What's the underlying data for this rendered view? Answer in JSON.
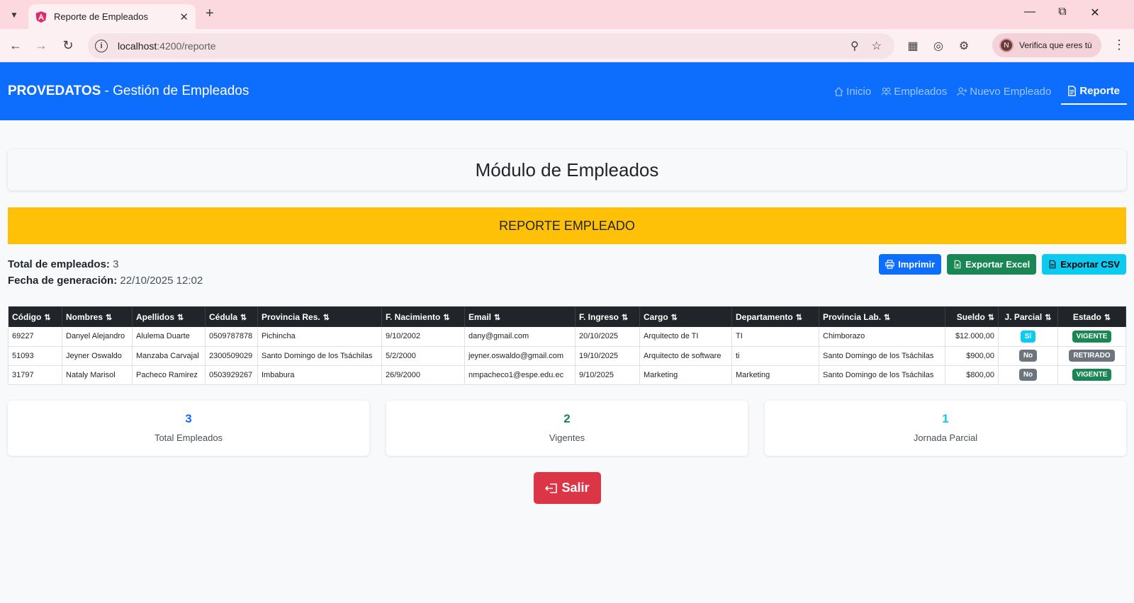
{
  "browser": {
    "tab_title": "Reporte de Empleados",
    "url_host": "localhost",
    "url_rest": ":4200/reporte",
    "profile_label": "Verifica que eres tú",
    "profile_initial": "N"
  },
  "navbar": {
    "brand_bold": "PROVEDATOS",
    "brand_rest": " - Gestión de Empleados",
    "links": [
      {
        "label": "Inicio",
        "icon": "house-icon"
      },
      {
        "label": "Empleados",
        "icon": "people-icon"
      },
      {
        "label": "Nuevo Empleado",
        "icon": "person-add-icon"
      },
      {
        "label": "Reporte",
        "icon": "file-text-icon",
        "active": true
      }
    ]
  },
  "page": {
    "title": "Módulo de Empleados",
    "banner": "REPORTE EMPLEADO",
    "total_label": "Total de empleados:",
    "total_value": "3",
    "fecha_label": "Fecha de generación:",
    "fecha_value": "22/10/2025 12:02"
  },
  "actions": {
    "print": "Imprimir",
    "excel": "Exportar Excel",
    "csv": "Exportar CSV"
  },
  "table": {
    "columns": [
      "Código",
      "Nombres",
      "Apellidos",
      "Cédula",
      "Provincia Res.",
      "F. Nacimiento",
      "Email",
      "F. Ingreso",
      "Cargo",
      "Departamento",
      "Provincia Lab.",
      "Sueldo",
      "J. Parcial",
      "Estado"
    ],
    "rows": [
      {
        "codigo": "69227",
        "nombres": "Danyel Alejandro",
        "apellidos": "Alulema Duarte",
        "cedula": "0509787878",
        "provincia_res": "Pichincha",
        "f_nacimiento": "9/10/2002",
        "email": "dany@gmail.com",
        "f_ingreso": "20/10/2025",
        "cargo": "Arquitecto de TI",
        "departamento": "TI",
        "provincia_lab": "Chimborazo",
        "sueldo": "$12.000,00",
        "j_parcial": "Sí",
        "estado": "VIGENTE"
      },
      {
        "codigo": "51093",
        "nombres": "Jeyner Oswaldo",
        "apellidos": "Manzaba Carvajal",
        "cedula": "2300509029",
        "provincia_res": "Santo Domingo de los Tsáchilas",
        "f_nacimiento": "5/2/2000",
        "email": "jeyner.oswaldo@gmail.com",
        "f_ingreso": "19/10/2025",
        "cargo": "Arquitecto de software",
        "departamento": "ti",
        "provincia_lab": "Santo Domingo de los Tsáchilas",
        "sueldo": "$900,00",
        "j_parcial": "No",
        "estado": "RETIRADO"
      },
      {
        "codigo": "31797",
        "nombres": "Nataly Marisol",
        "apellidos": "Pacheco Ramirez",
        "cedula": "0503929267",
        "provincia_res": "Imbabura",
        "f_nacimiento": "26/9/2000",
        "email": "nmpacheco1@espe.edu.ec",
        "f_ingreso": "9/10/2025",
        "cargo": "Marketing",
        "departamento": "Marketing",
        "provincia_lab": "Santo Domingo de los Tsáchilas",
        "sueldo": "$800,00",
        "j_parcial": "No",
        "estado": "VIGENTE"
      }
    ]
  },
  "stats": [
    {
      "value": "3",
      "label": "Total Empleados",
      "color": "#0d6efd"
    },
    {
      "value": "2",
      "label": "Vigentes",
      "color": "#198754"
    },
    {
      "value": "1",
      "label": "Jornada Parcial",
      "color": "#0dcaf0"
    }
  ],
  "salir_label": "Salir"
}
